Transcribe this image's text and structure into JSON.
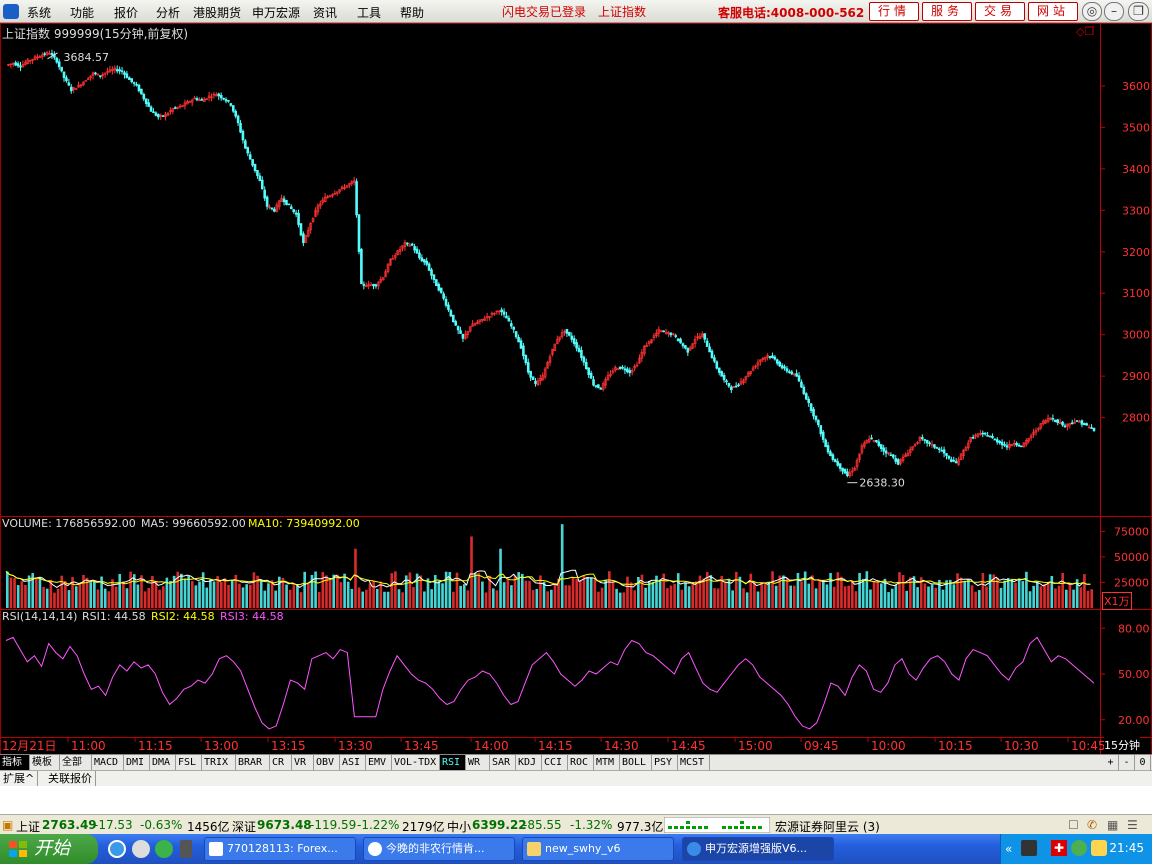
{
  "menu": {
    "items": [
      "系统",
      "功能",
      "报价",
      "分析",
      "港股期货",
      "申万宏源",
      "资讯",
      "工具",
      "帮助"
    ],
    "alerts": [
      "闪电交易已登录",
      "上证指数"
    ],
    "hotline": "客服电话:4008-000-562",
    "nav_buttons": [
      "行情",
      "服务",
      "交易",
      "网站"
    ]
  },
  "chart_header": {
    "title": "上证指数 999999(15分钟,前复权)",
    "high_label": "3684.57",
    "low_label": "2638.30"
  },
  "volume_header": {
    "volume": "VOLUME: 176856592.00",
    "ma5": "MA5: 99660592.00",
    "ma10": "MA10: 73940992.00",
    "unit": "X1万"
  },
  "rsi_header": {
    "label": "RSI(14,14,14)",
    "rsi1": "RSI1: 44.58",
    "rsi2": "RSI2: 44.58",
    "rsi3": "RSI3: 44.58"
  },
  "time_axis": {
    "date_label": "12月21日",
    "ticks": [
      "11:00",
      "11:15",
      "13:00",
      "13:15",
      "13:30",
      "13:45",
      "14:00",
      "14:15",
      "14:30",
      "14:45",
      "15:00",
      "09:45",
      "10:00",
      "10:15",
      "10:30",
      "10:45"
    ],
    "period": "15分钟"
  },
  "chart_data": [
    {
      "type": "candlestick",
      "title": "上证指数 999999(15分钟,前复权)",
      "ylim": [
        2570,
        3730
      ],
      "y_ticks": [
        3600,
        3500,
        3400,
        3300,
        3200,
        3100,
        3000,
        2900,
        2800
      ],
      "high": 3684.57,
      "low": 2638.3,
      "close_path": [
        3650,
        3655,
        3648,
        3660,
        3668,
        3675,
        3680,
        3660,
        3620,
        3590,
        3600,
        3615,
        3630,
        3625,
        3635,
        3640,
        3635,
        3615,
        3600,
        3570,
        3540,
        3525,
        3530,
        3545,
        3550,
        3560,
        3570,
        3565,
        3575,
        3580,
        3570,
        3555,
        3510,
        3450,
        3410,
        3370,
        3310,
        3300,
        3330,
        3310,
        3290,
        3220,
        3270,
        3310,
        3330,
        3340,
        3350,
        3360,
        3370,
        3120,
        3120,
        3120,
        3140,
        3180,
        3200,
        3220,
        3215,
        3185,
        3170,
        3130,
        3100,
        3060,
        3020,
        2990,
        3020,
        3030,
        3040,
        3050,
        3060,
        3040,
        3010,
        2970,
        2910,
        2880,
        2900,
        2950,
        2990,
        3010,
        2990,
        2960,
        2920,
        2880,
        2870,
        2900,
        2920,
        2920,
        2910,
        2930,
        2970,
        2990,
        3010,
        3005,
        3000,
        2980,
        2960,
        2990,
        3000,
        2960,
        2920,
        2890,
        2870,
        2880,
        2900,
        2920,
        2940,
        2950,
        2940,
        2920,
        2910,
        2900,
        2860,
        2820,
        2780,
        2730,
        2700,
        2680,
        2660,
        2680,
        2730,
        2750,
        2740,
        2720,
        2710,
        2690,
        2710,
        2730,
        2750,
        2740,
        2730,
        2720,
        2700,
        2690,
        2720,
        2750,
        2760,
        2760,
        2750,
        2740,
        2730,
        2740,
        2730,
        2750,
        2770,
        2790,
        2800,
        2790,
        2780,
        2790,
        2790,
        2780,
        2770
      ],
      "color_up": "#ff3232",
      "color_down": "#54fcfc"
    },
    {
      "type": "bar",
      "title": "VOLUME",
      "ylim": [
        0,
        90000
      ],
      "y_ticks": [
        75000,
        50000,
        25000
      ],
      "unit": "X1万",
      "peaks": [
        70000,
        82000
      ],
      "typical": [
        15000,
        45000
      ],
      "ma5_color": "#ffffff",
      "ma10_color": "#ffff00"
    },
    {
      "type": "line",
      "title": "RSI(14,14,14)",
      "ylim": [
        10,
        90
      ],
      "y_ticks": [
        80.0,
        50.0,
        20.0
      ],
      "values": [
        72,
        74,
        66,
        58,
        62,
        55,
        70,
        64,
        60,
        68,
        62,
        50,
        40,
        42,
        36,
        48,
        56,
        52,
        58,
        54,
        56,
        50,
        38,
        30,
        34,
        40,
        42,
        46,
        44,
        50,
        60,
        62,
        58,
        52,
        40,
        28,
        18,
        14,
        16,
        30,
        46,
        44,
        40,
        60,
        62,
        64,
        60,
        66,
        64,
        22,
        22,
        22,
        22,
        40,
        52,
        62,
        56,
        50,
        46,
        44,
        40,
        34,
        30,
        32,
        40,
        46,
        48,
        52,
        50,
        44,
        36,
        30,
        32,
        44,
        56,
        60,
        64,
        58,
        50,
        46,
        42,
        46,
        52,
        50,
        54,
        58,
        56,
        66,
        72,
        70,
        64,
        62,
        58,
        54,
        50,
        60,
        64,
        54,
        44,
        40,
        38,
        44,
        50,
        56,
        60,
        56,
        48,
        44,
        40,
        36,
        30,
        22,
        16,
        14,
        18,
        30,
        44,
        42,
        36,
        48,
        56,
        52,
        40,
        38,
        44,
        56,
        60,
        50,
        46,
        54,
        60,
        62,
        58,
        50,
        46,
        60,
        66,
        64,
        62,
        56,
        50,
        46,
        54,
        58,
        70,
        74,
        66,
        58,
        62,
        60,
        56,
        52,
        48,
        44
      ]
    }
  ],
  "indicator_tabs": [
    "指标",
    "模板",
    "全部",
    "MACD",
    "DMI",
    "DMA",
    "FSL",
    "TRIX",
    "BRAR",
    "CR",
    "VR",
    "OBV",
    "ASI",
    "EMV",
    "VOL-TDX",
    "RSI",
    "WR",
    "SAR",
    "KDJ",
    "CCI",
    "ROC",
    "MTM",
    "BOLL",
    "PSY",
    "MCST"
  ],
  "active_tab": "RSI",
  "tab_controls": [
    "+",
    "-",
    "0"
  ],
  "sub_tabs": [
    "扩展^",
    "关联报价"
  ],
  "status": {
    "sh_name": "上证",
    "sh_price": "2763.49",
    "sh_chg": "-17.53",
    "sh_pct": "-0.63%",
    "sh_amt": "1456亿",
    "sz_name": "深证",
    "sz_price": "9673.48",
    "sz_chg": "-119.59",
    "sz_pct": "-1.22%",
    "sz_amt": "2179亿",
    "zx_name": "中小",
    "zx_price": "6399.22",
    "zx_chg": "-85.55",
    "zx_pct": "-1.32%",
    "zx_amt": "977.3亿",
    "broker": "宏源证券阿里云 (3)"
  },
  "taskbar": {
    "start": "开始",
    "tasks": [
      "770128113: Forex...",
      "今晚的非农行情肯...",
      "new_swhy_v6",
      "申万宏源增强版V6..."
    ],
    "clock": "21:45"
  }
}
